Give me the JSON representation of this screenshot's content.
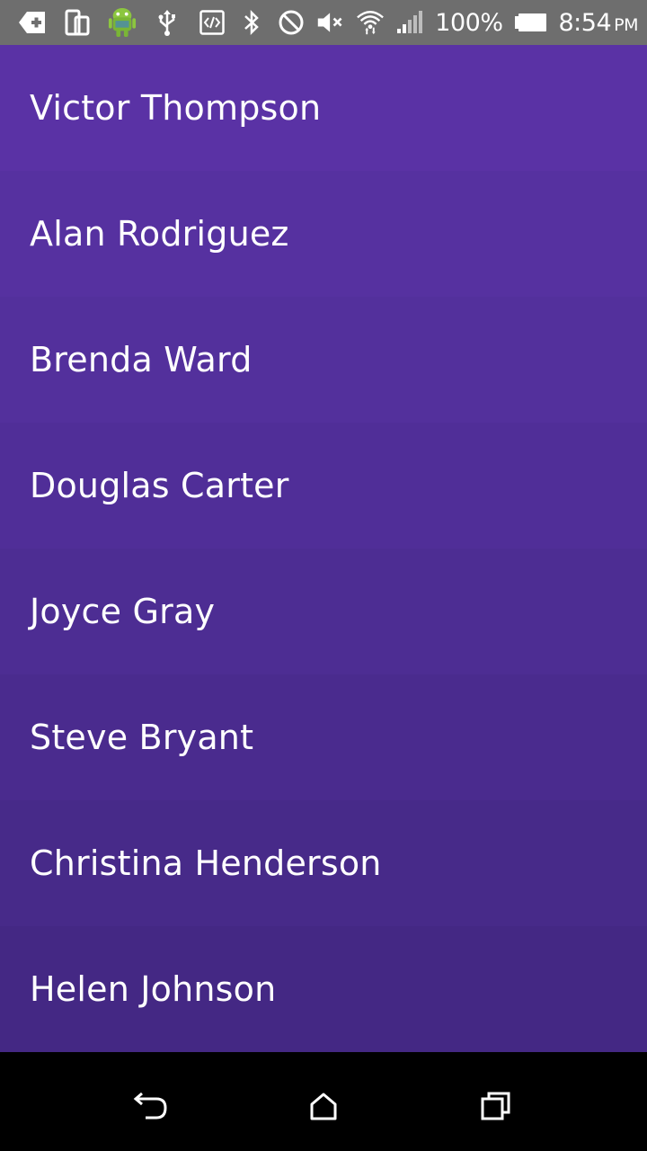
{
  "status_bar": {
    "battery_percent": "100%",
    "time": "8:54",
    "ampm": "PM",
    "icons_left": [
      "add-notification-icon",
      "device-rotate-icon",
      "android-robot-icon",
      "usb-icon",
      "developer-code-icon"
    ],
    "icons_right": [
      "bluetooth-icon",
      "do-not-disturb-icon",
      "volume-muted-icon",
      "wifi-icon",
      "cell-signal-icon",
      "battery-icon"
    ]
  },
  "contacts": [
    {
      "name": "Victor Thompson",
      "bg": "#5a32a5"
    },
    {
      "name": "Alan Rodriguez",
      "bg": "#5631a0"
    },
    {
      "name": "Brenda Ward",
      "bg": "#53309c"
    },
    {
      "name": "Douglas Carter",
      "bg": "#502e98"
    },
    {
      "name": "Joyce Gray",
      "bg": "#4d2d93"
    },
    {
      "name": "Steve Bryant",
      "bg": "#4a2b8e"
    },
    {
      "name": "Christina Henderson",
      "bg": "#472a89"
    },
    {
      "name": "Helen Johnson",
      "bg": "#442884"
    }
  ],
  "nav_bar": {
    "icons": [
      "back-icon",
      "home-icon",
      "recent-apps-icon"
    ]
  }
}
